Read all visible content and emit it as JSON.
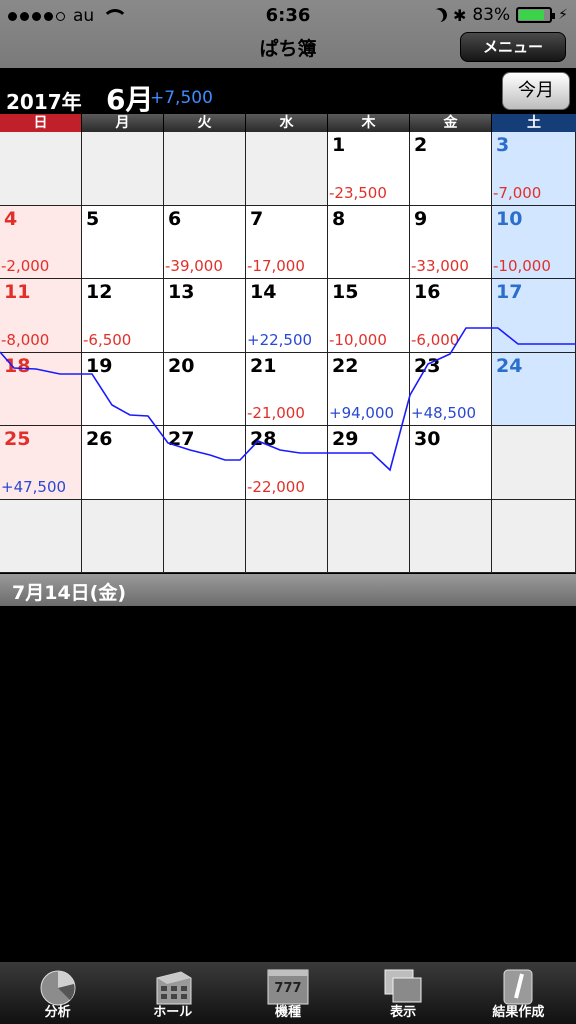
{
  "status": {
    "carrier": "au",
    "time": "6:36",
    "battery": "83%",
    "battery_level": 0.83
  },
  "nav": {
    "title": "ぱち簿",
    "menu_label": "メニュー"
  },
  "month": {
    "year": "2017年",
    "month": "6月",
    "total": "+7,500",
    "today_label": "今月"
  },
  "weekdays": [
    "日",
    "月",
    "火",
    "水",
    "木",
    "金",
    "土"
  ],
  "weeks": [
    [
      {
        "day": "",
        "amount": ""
      },
      {
        "day": "",
        "amount": ""
      },
      {
        "day": "",
        "amount": ""
      },
      {
        "day": "",
        "amount": ""
      },
      {
        "day": "1",
        "amount": "-23,500"
      },
      {
        "day": "2",
        "amount": ""
      },
      {
        "day": "3",
        "amount": "-7,000"
      }
    ],
    [
      {
        "day": "4",
        "amount": "-2,000"
      },
      {
        "day": "5",
        "amount": ""
      },
      {
        "day": "6",
        "amount": "-39,000"
      },
      {
        "day": "7",
        "amount": "-17,000"
      },
      {
        "day": "8",
        "amount": ""
      },
      {
        "day": "9",
        "amount": "-33,000"
      },
      {
        "day": "10",
        "amount": "-10,000"
      }
    ],
    [
      {
        "day": "11",
        "amount": "-8,000"
      },
      {
        "day": "12",
        "amount": "-6,500"
      },
      {
        "day": "13",
        "amount": ""
      },
      {
        "day": "14",
        "amount": "+22,500"
      },
      {
        "day": "15",
        "amount": "-10,000"
      },
      {
        "day": "16",
        "amount": "-6,000"
      },
      {
        "day": "17",
        "amount": ""
      }
    ],
    [
      {
        "day": "18",
        "amount": ""
      },
      {
        "day": "19",
        "amount": ""
      },
      {
        "day": "20",
        "amount": ""
      },
      {
        "day": "21",
        "amount": "-21,000"
      },
      {
        "day": "22",
        "amount": "+94,000"
      },
      {
        "day": "23",
        "amount": "+48,500"
      },
      {
        "day": "24",
        "amount": ""
      }
    ],
    [
      {
        "day": "25",
        "amount": "+47,500"
      },
      {
        "day": "26",
        "amount": ""
      },
      {
        "day": "27",
        "amount": ""
      },
      {
        "day": "28",
        "amount": "-22,000"
      },
      {
        "day": "29",
        "amount": ""
      },
      {
        "day": "30",
        "amount": ""
      },
      {
        "day": "",
        "amount": ""
      }
    ],
    [
      {
        "day": "",
        "amount": ""
      },
      {
        "day": "",
        "amount": ""
      },
      {
        "day": "",
        "amount": ""
      },
      {
        "day": "",
        "amount": ""
      },
      {
        "day": "",
        "amount": ""
      },
      {
        "day": "",
        "amount": ""
      },
      {
        "day": "",
        "amount": ""
      }
    ]
  ],
  "selected_date": "7月14日(金)",
  "tabs": [
    {
      "label": "分析",
      "icon": "pie-chart-icon"
    },
    {
      "label": "ホール",
      "icon": "building-icon"
    },
    {
      "label": "機種",
      "icon": "slot-machine-icon"
    },
    {
      "label": "表示",
      "icon": "display-icon"
    },
    {
      "label": "結果作成",
      "icon": "edit-icon"
    }
  ],
  "colors": {
    "negative": "#e0302a",
    "positive": "#2a48d4",
    "total": "#3c8cff",
    "trend_line": "#1a1aff",
    "sunday": "#c0202a",
    "saturday": "#153e78"
  }
}
